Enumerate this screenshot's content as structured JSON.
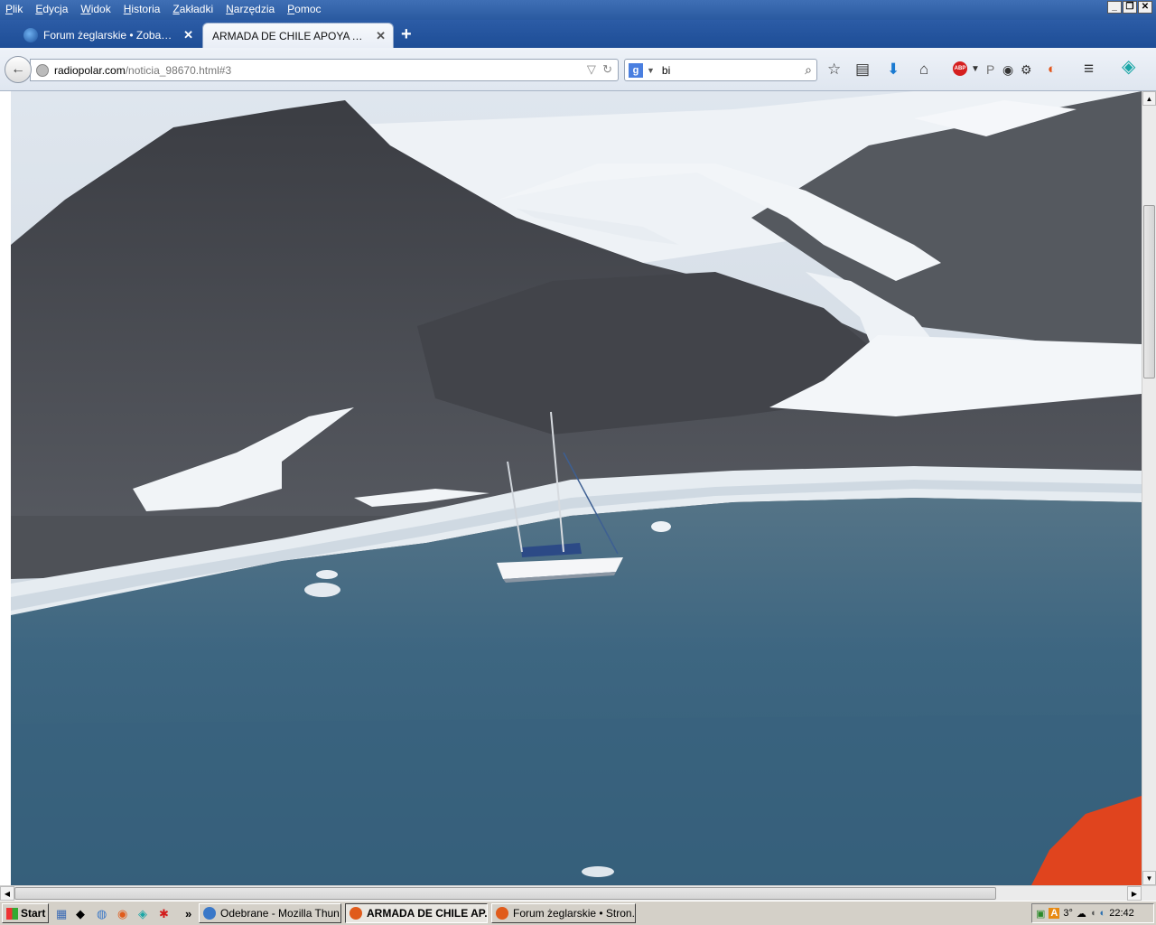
{
  "menu": [
    "Plik",
    "Edycja",
    "Widok",
    "Historia",
    "Zakładki",
    "Narzędzia",
    "Pomoc"
  ],
  "tabs": [
    {
      "label": "Forum żeglarskie • Zobacz wą...",
      "active": false
    },
    {
      "label": "ARMADA DE CHILE APOYA A YAT...",
      "active": true
    }
  ],
  "url": {
    "host": "radiopolar.com",
    "path": "/noticia_98670.html#3"
  },
  "search": {
    "engine_letter": "g",
    "value": "bi"
  },
  "taskbar": {
    "start": "Start",
    "tasks": [
      {
        "label": "Odebrane - Mozilla Thun...",
        "active": false
      },
      {
        "label": "ARMADA DE CHILE AP...",
        "active": true
      },
      {
        "label": "Forum żeglarskie • Stron...",
        "active": false
      }
    ],
    "temperature": "3°",
    "clock": "22:42",
    "more": "»"
  },
  "colors": {
    "menubar": "#2f62ab",
    "tabbar": "#1d4d96",
    "water": "#3a6480",
    "rock": "#4b4e55",
    "snow": "#f1f4f7"
  },
  "icons": [
    "back-arrow-icon",
    "globe-icon",
    "reload-icon",
    "star-icon",
    "reading-list-icon",
    "download-icon",
    "home-icon",
    "adblock-icon",
    "menu-icon"
  ]
}
